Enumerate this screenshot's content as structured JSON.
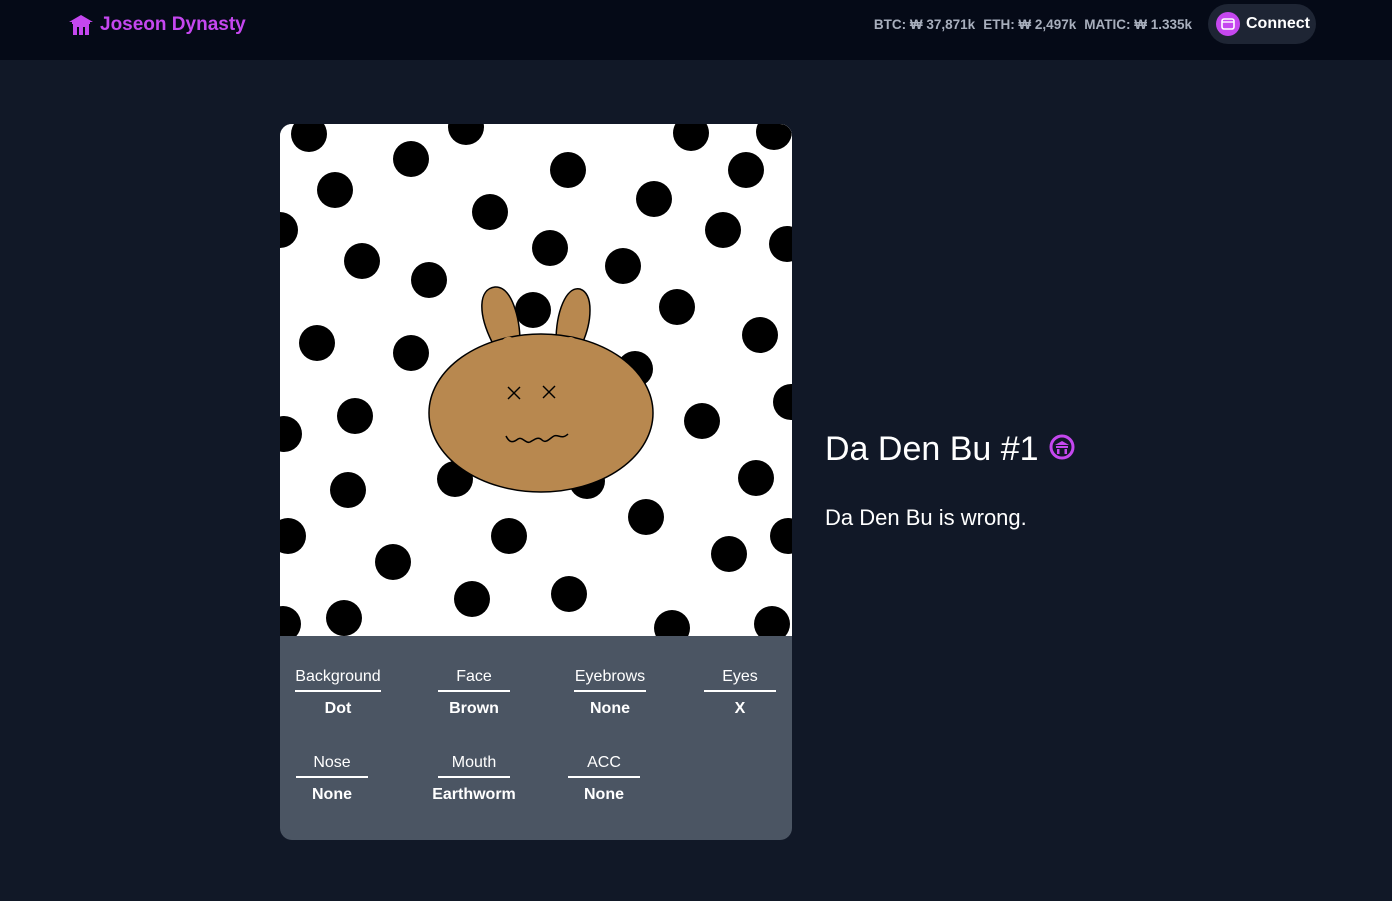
{
  "header": {
    "brand": "Joseon Dynasty",
    "prices": [
      {
        "label": "BTC: ₩ 37,871k"
      },
      {
        "label": "ETH: ₩ 2,497k"
      },
      {
        "label": "MATIC: ₩ 1.335k"
      }
    ],
    "connect_label": "Connect",
    "icons": {
      "brand": "palace-icon",
      "wallet": "wallet-icon"
    }
  },
  "nft": {
    "title": "Da Den Bu #1",
    "badge_icon": "palace-badge-icon",
    "description": "Da Den Bu is wrong.",
    "traits": [
      {
        "label": "Background",
        "value": "Dot"
      },
      {
        "label": "Face",
        "value": "Brown"
      },
      {
        "label": "Eyebrows",
        "value": "None"
      },
      {
        "label": "Eyes",
        "value": "X"
      },
      {
        "label": "Nose",
        "value": "None"
      },
      {
        "label": "Mouth",
        "value": "Earthworm"
      },
      {
        "label": "ACC",
        "value": "None"
      }
    ]
  },
  "colors": {
    "accent": "#c547ef",
    "page_bg": "#111827",
    "header_bg": "#050a17",
    "trait_panel": "#4b5563",
    "face": "#b8884f"
  }
}
